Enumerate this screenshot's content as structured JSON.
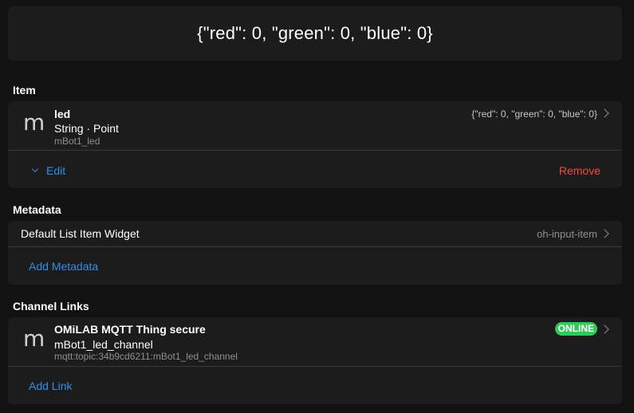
{
  "state": {
    "value": "{\"red\": 0, \"green\": 0, \"blue\": 0}"
  },
  "item_section": {
    "title": "Item",
    "item": {
      "avatar": "m",
      "name": "led",
      "type": "String · Point",
      "label": "mBot1_led",
      "state": "{\"red\": 0, \"green\": 0, \"blue\": 0}"
    },
    "edit_label": "Edit",
    "remove_label": "Remove"
  },
  "metadata_section": {
    "title": "Metadata",
    "widget_label": "Default List Item Widget",
    "widget_value": "oh-input-item",
    "add_label": "Add Metadata"
  },
  "channel_section": {
    "title": "Channel Links",
    "link": {
      "avatar": "m",
      "thing": "OMiLAB MQTT Thing secure",
      "channel": "mBot1_led_channel",
      "uid": "mqtt:topic:34b9cd6211:mBot1_led_channel",
      "status": "ONLINE"
    },
    "add_label": "Add Link"
  },
  "icons": {
    "chevron_right": "chevron-right-icon",
    "chevron_down": "chevron-down-icon"
  },
  "colors": {
    "background": "#121212",
    "card": "#1c1c1d",
    "accent": "#2f8fe8",
    "danger": "#ff453a",
    "online": "#34c759"
  }
}
